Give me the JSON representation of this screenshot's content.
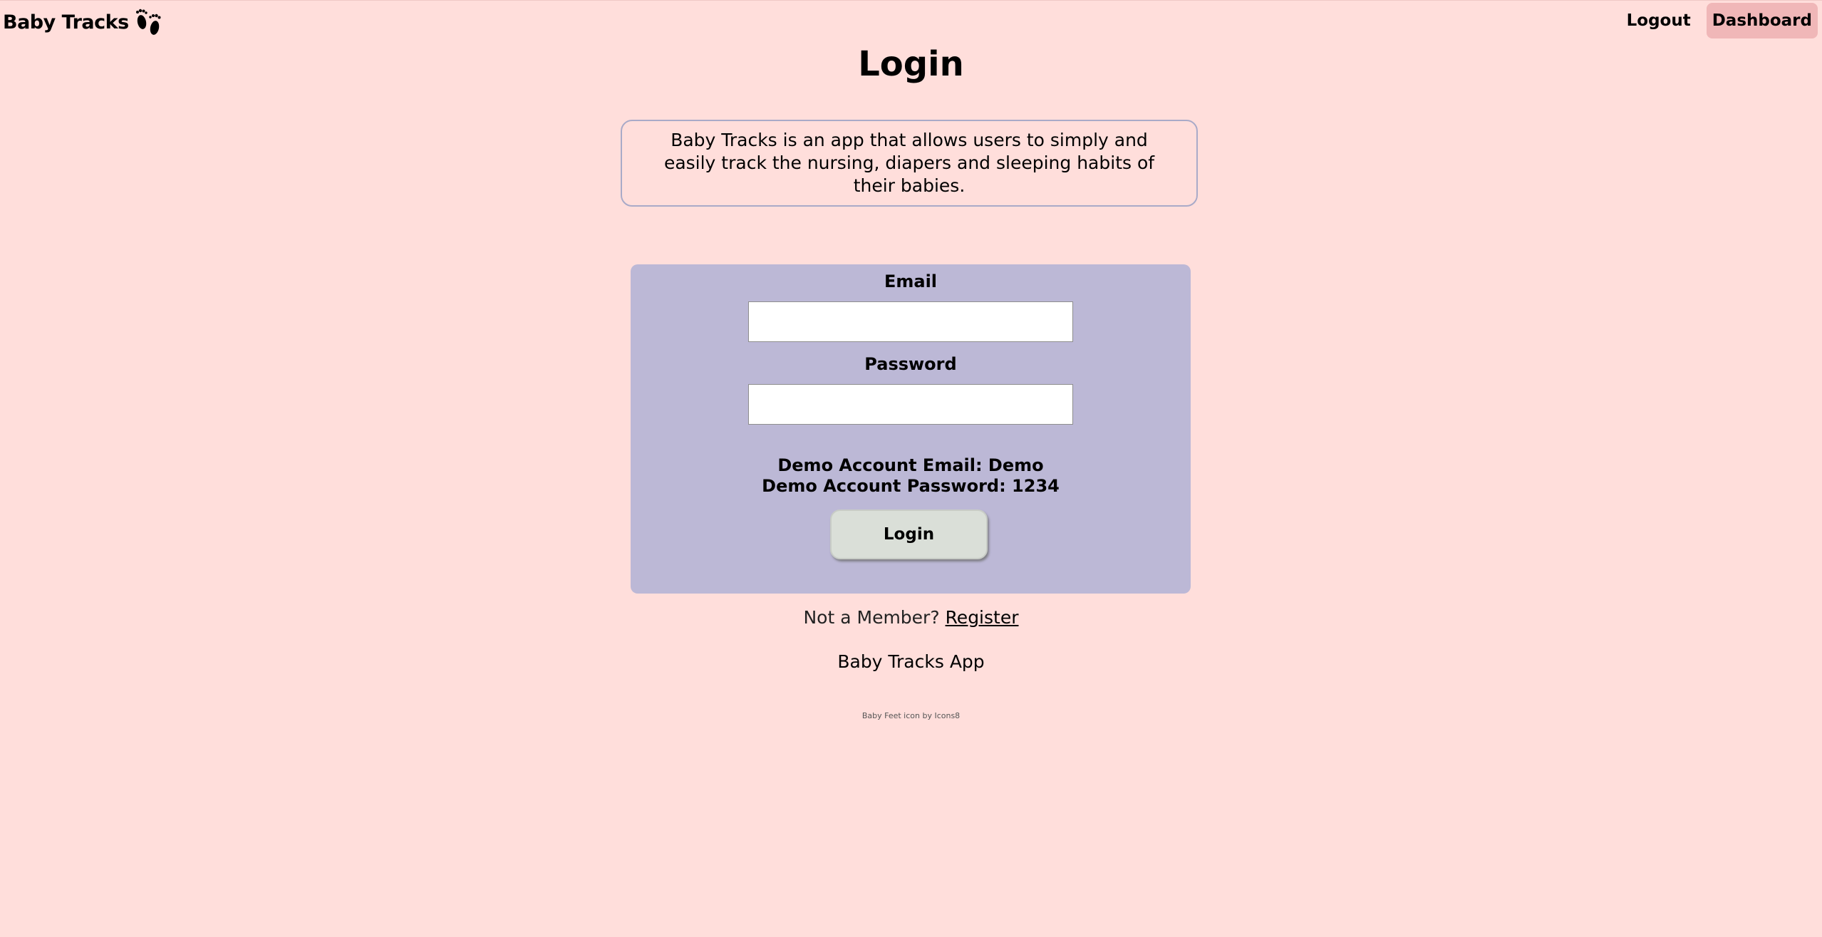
{
  "nav": {
    "brand": "Baby Tracks",
    "brand_icon": "baby-feet-icon",
    "logout": "Logout",
    "dashboard": "Dashboard"
  },
  "page": {
    "title": "Login"
  },
  "about": {
    "text": "Baby Tracks is an app that allows users to simply and easily track the nursing, diapers and sleeping habits of their babies."
  },
  "form": {
    "email_label": "Email",
    "email_value": "",
    "password_label": "Password",
    "password_value": "",
    "demo_email": "Demo Account Email: Demo",
    "demo_password": "Demo Account Password: 1234",
    "submit": "Login"
  },
  "register": {
    "prompt": "Not a Member?",
    "link": "Register"
  },
  "footer": {
    "title": "Baby Tracks App",
    "credit": "Baby Feet icon by Icons8"
  },
  "colors": {
    "background": "#ffdedb",
    "card": "#bcb8d6",
    "active_nav": "#f0b7b8",
    "button": "#dadfd8",
    "about_border": "#a9aac8"
  }
}
